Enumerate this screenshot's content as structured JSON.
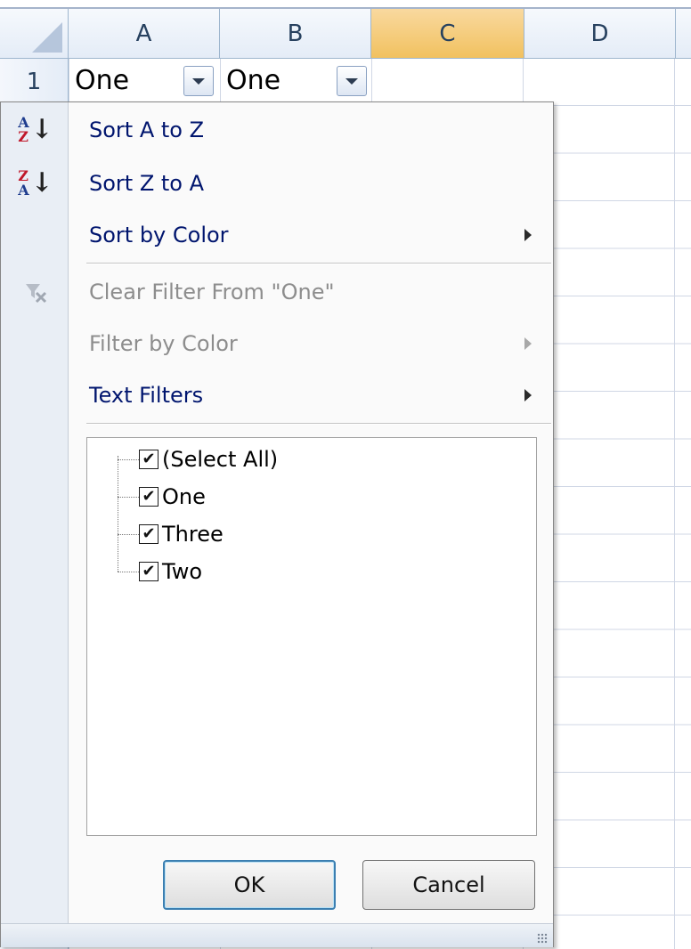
{
  "columns": [
    "A",
    "B",
    "C",
    "D"
  ],
  "active_column": "C",
  "row_number": "1",
  "cells": {
    "a1": "One",
    "b1": "One"
  },
  "menu": {
    "sort_az": "Sort A to Z",
    "sort_za": "Sort Z to A",
    "sort_by_color": "Sort by Color",
    "clear_filter": "Clear Filter From \"One\"",
    "filter_by_color": "Filter by Color",
    "text_filters": "Text Filters",
    "checklist": [
      {
        "label": "(Select All)",
        "checked": true
      },
      {
        "label": "One",
        "checked": true
      },
      {
        "label": "Three",
        "checked": true
      },
      {
        "label": "Two",
        "checked": true
      }
    ],
    "ok_label": "OK",
    "cancel_label": "Cancel"
  },
  "icons": {
    "sort_az": "sort-az-icon",
    "sort_za": "sort-za-icon",
    "clear_filter": "clear-filter-icon"
  },
  "colors": {
    "menu_text": "#00156e",
    "disabled_text": "#8d8d8d",
    "active_header": "#f1c15f",
    "sort_glyph_red": "#c0182a",
    "sort_glyph_blue": "#1f3d8e"
  }
}
